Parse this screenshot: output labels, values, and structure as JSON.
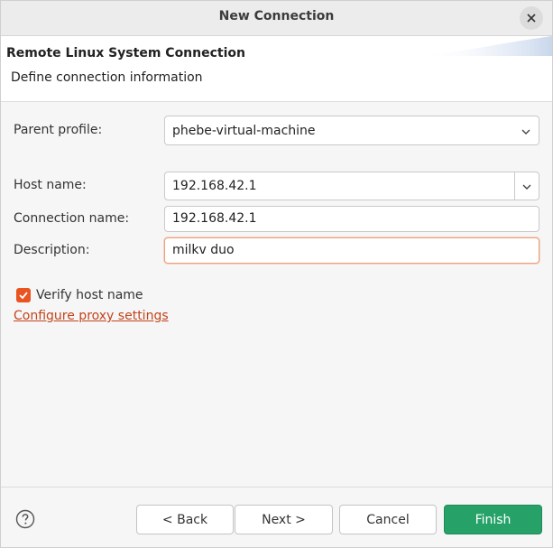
{
  "window": {
    "title": "New Connection"
  },
  "header": {
    "title": "Remote Linux System Connection",
    "description": "Define connection information"
  },
  "form": {
    "parent_profile": {
      "label": "Parent profile:",
      "value": "phebe-virtual-machine"
    },
    "host_name": {
      "label": "Host name:",
      "value": "192.168.42.1"
    },
    "connection_name": {
      "label": "Connection name:",
      "value": "192.168.42.1"
    },
    "description": {
      "label": "Description:",
      "value": "milkv duo"
    },
    "verify_host": {
      "label": "Verify host name",
      "checked": true
    },
    "proxy_link": "Configure proxy settings"
  },
  "footer": {
    "help_icon": "help-icon",
    "back_label": "< Back",
    "next_label": "Next >",
    "cancel_label": "Cancel",
    "finish_label": "Finish"
  },
  "colors": {
    "accent": "#e95420",
    "finish_button": "#26a269",
    "link": "#c2441c"
  }
}
